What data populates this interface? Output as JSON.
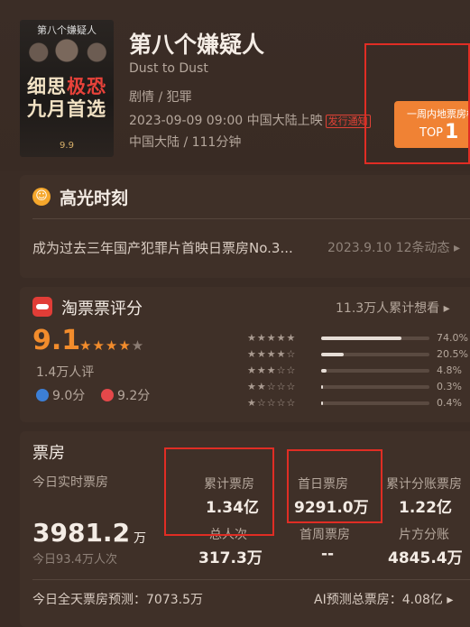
{
  "movie": {
    "poster": {
      "title_text": "第八个嫌疑人",
      "slogan_line1_a": "细思",
      "slogan_line1_b": "极恐",
      "slogan_line2": "九月首选",
      "date_text": "9.9"
    },
    "title": "第八个嫌疑人",
    "subtitle": "Dust to Dust",
    "genre": "剧情 / 犯罪",
    "release": "2023-09-09 09:00 中国大陆上映",
    "release_notice": "发行通知",
    "meta": "中国大陆 / 111分钟",
    "rank": {
      "line1": "一周内地票房榜",
      "prefix": "TOP",
      "number": "1"
    }
  },
  "highlights": {
    "title": "高光时刻",
    "text": "成为过去三年国产犯罪片首映日票房No.3...",
    "date_dynamic": "2023.9.10 12条动态 ▸"
  },
  "taopiaopiao": {
    "title": "淘票票评分",
    "want": "11.3万人累计想看 ▸",
    "score": "9.1",
    "stars_filled": "★★★★",
    "stars_empty": "★",
    "raters": "1.4万人评",
    "male_score": "9.0分",
    "female_score": "9.2分",
    "distribution": [
      {
        "stars": "★★★★★",
        "pct": "74.0%",
        "fraction": 0.74
      },
      {
        "stars": "★★★★☆",
        "pct": "20.5%",
        "fraction": 0.205
      },
      {
        "stars": "★★★☆☆",
        "pct": "4.8%",
        "fraction": 0.048
      },
      {
        "stars": "★★☆☆☆",
        "pct": "0.3%",
        "fraction": 0.003
      },
      {
        "stars": "★☆☆☆☆",
        "pct": "0.4%",
        "fraction": 0.004
      }
    ]
  },
  "box_office": {
    "title": "票房",
    "realtime_label": "今日实时票房",
    "realtime_value": "3981.2",
    "realtime_unit": "万",
    "realtime_sub": "今日93.4万人次",
    "cumulative_label": "累计票房",
    "cumulative_value": "1.34亿",
    "first_day_label": "首日票房",
    "first_day_value": "9291.0万",
    "split_label": "累计分账票房",
    "split_value": "1.22亿",
    "total_admissions_label": "总人次",
    "total_admissions_value": "317.3万",
    "first_week_label": "首周票房",
    "first_week_value": "--",
    "producer_share_label": "片方分账",
    "producer_share_value": "4845.4万",
    "forecast_today": "今日全天票房预测：7073.5万",
    "ai_forecast": "AI预测总票房：4.08亿 ▸"
  }
}
